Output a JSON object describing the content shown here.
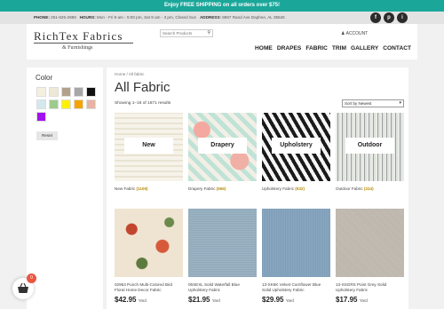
{
  "promo": "Enjoy FREE SHIPPING on all orders over $75!",
  "info": {
    "phone_label": "PHONE:",
    "phone": "251-625-2889",
    "hours_label": "HOURS:",
    "hours": "Mon - Fri 9 am - 5:00 pm, Sat 9 am - 3 pm, Closed Sun",
    "address_label": "ADDRESS:",
    "address": "8967 Rand Ave Daphne, AL 36526"
  },
  "socials": [
    "f",
    "p",
    "i"
  ],
  "logo": {
    "main": "RichTex Fabrics",
    "sub": "& Furnishings"
  },
  "search": {
    "placeholder": "Search Products"
  },
  "account": "ACCOUNT",
  "nav": [
    "HOME",
    "DRAPES",
    "FABRIC",
    "TRIM",
    "GALLERY",
    "CONTACT"
  ],
  "sidebar": {
    "title": "Color",
    "swatches": [
      "#f4efe0",
      "#ede9d6",
      "#b3a08b",
      "#a7a7a7",
      "#111111",
      "#d3e8ef",
      "#9ccc8c",
      "#fff200",
      "#f4a300",
      "#e7b3a2",
      "#a312ef"
    ],
    "reset": "Reset"
  },
  "breadcrumb": "Home / All fabric",
  "page_title": "All Fabric",
  "results": "Showing 1–16 of 1671 results",
  "sort": {
    "value": "Sort by Newest"
  },
  "products": [
    {
      "name": "New Fabric",
      "count": "(1109)",
      "tile": "New",
      "price": "",
      "unit": ""
    },
    {
      "name": "Drapery Fabric",
      "count": "(659)",
      "tile": "Drapery",
      "price": "",
      "unit": ""
    },
    {
      "name": "Upholstery Fabric",
      "count": "(932)",
      "tile": "Upholstery",
      "price": "",
      "unit": ""
    },
    {
      "name": "Outdoor Fabric",
      "count": "(224)",
      "tile": "Outdoor",
      "price": "",
      "unit": ""
    },
    {
      "name": "02953 Punch Multi-Colored Bird Floral Home Decor Fabric",
      "count": "",
      "tile": "",
      "price": "$42.95",
      "unit": "Yard"
    },
    {
      "name": "05SEXL Solid Waterfall Blue Upholstery Fabric",
      "count": "",
      "tile": "",
      "price": "$21.95",
      "unit": "Yard"
    },
    {
      "name": "13-XK6K Velvet Cornflower Blue Solid Upholstery Fabric",
      "count": "",
      "tile": "",
      "price": "$29.95",
      "unit": "Yard"
    },
    {
      "name": "13-SSGRS Point Grey Solid Upholstery Fabric",
      "count": "",
      "tile": "",
      "price": "$17.95",
      "unit": "Yard"
    }
  ],
  "cart": {
    "count": "0"
  }
}
